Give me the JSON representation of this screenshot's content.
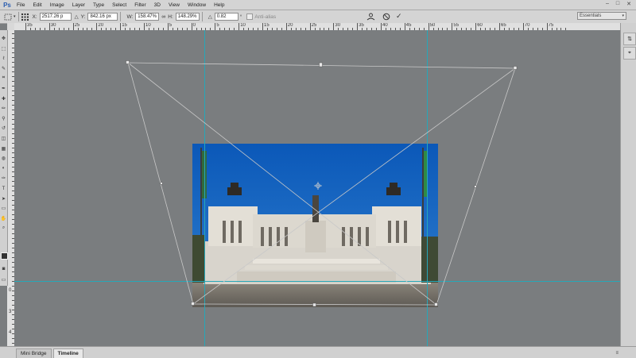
{
  "app": {
    "logo": "Ps"
  },
  "menu": {
    "items": [
      "File",
      "Edit",
      "Image",
      "Layer",
      "Type",
      "Select",
      "Filter",
      "3D",
      "View",
      "Window",
      "Help"
    ]
  },
  "window_controls": {
    "minimize": "–",
    "maximize": "□",
    "close": "✕"
  },
  "options": {
    "x_label": "X:",
    "x_value": "2517.26 p",
    "y_label": "Y:",
    "y_value": "842.16 px",
    "w_label": "W:",
    "w_value": "158.47%",
    "h_label": "H:",
    "h_value": "148.29%",
    "angle_label": "△",
    "angle_value": "0.82",
    "degree_unit": "°",
    "antialias_label": "Anti-alias",
    "workspace": "Essentials"
  },
  "rulers": {
    "top_labels": [
      "35",
      "30",
      "25",
      "20",
      "15",
      "10",
      "5",
      "0",
      "5",
      "10",
      "15",
      "20",
      "25",
      "30",
      "35",
      "40",
      "45",
      "50",
      "55",
      "60",
      "65",
      "70",
      "75"
    ],
    "left_labels": [
      "0",
      "3",
      "4"
    ]
  },
  "bottom_tabs": [
    {
      "label": "Mini Bridge",
      "active": false
    },
    {
      "label": "Timeline",
      "active": true
    }
  ],
  "icons": [
    "move-icon",
    "marquee-icon",
    "lasso-icon",
    "quick-select-icon",
    "crop-icon",
    "eyedropper-icon",
    "healing-icon",
    "brush-icon",
    "stamp-icon",
    "history-brush-icon",
    "eraser-icon",
    "gradient-icon",
    "blur-icon",
    "dodge-icon",
    "pen-icon",
    "type-icon",
    "path-select-icon",
    "shape-icon",
    "hand-icon",
    "zoom-icon"
  ]
}
